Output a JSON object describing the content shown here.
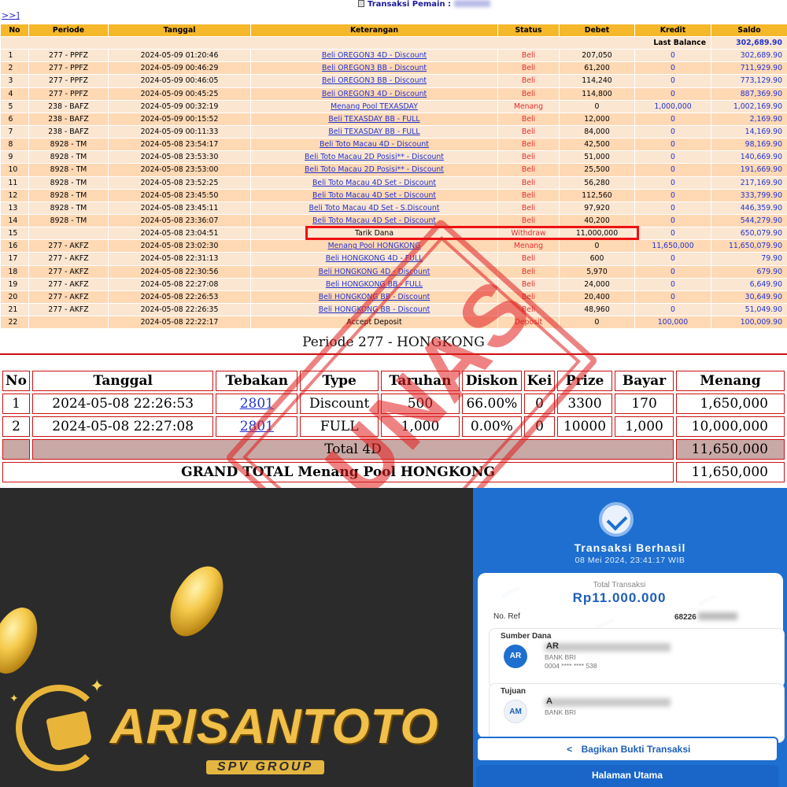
{
  "header": {
    "nav_label": ">>]",
    "title": "Transaksi   Pemain :",
    "player_icon": "document-icon"
  },
  "tx_table": {
    "columns": [
      "No",
      "Periode",
      "Tanggal",
      "Keterangan",
      "Status",
      "Debet",
      "Kredit",
      "Saldo"
    ],
    "last_balance_label": "Last Balance",
    "last_balance_value": "302,689.90",
    "rows": [
      {
        "no": "1",
        "periode": "277 - PPFZ",
        "tanggal": "2024-05-09 01:20:46",
        "ket": "Beli OREGON3 4D - Discount",
        "status": "Beli",
        "debet": "207,050",
        "kredit": "0",
        "saldo": "302,689.90",
        "link": true,
        "highlight": false
      },
      {
        "no": "2",
        "periode": "277 - PPFZ",
        "tanggal": "2024-05-09 00:46:29",
        "ket": "Beli OREGON3 BB - Discount",
        "status": "Beli",
        "debet": "61,200",
        "kredit": "0",
        "saldo": "711,929.90",
        "link": true,
        "highlight": false
      },
      {
        "no": "3",
        "periode": "277 - PPFZ",
        "tanggal": "2024-05-09 00:46:05",
        "ket": "Beli OREGON3 BB - Discount",
        "status": "Beli",
        "debet": "114,240",
        "kredit": "0",
        "saldo": "773,129.90",
        "link": true,
        "highlight": false
      },
      {
        "no": "4",
        "periode": "277 - PPFZ",
        "tanggal": "2024-05-09 00:45:25",
        "ket": "Beli OREGON3 4D - Discount",
        "status": "Beli",
        "debet": "114,800",
        "kredit": "0",
        "saldo": "887,369.90",
        "link": true,
        "highlight": false
      },
      {
        "no": "5",
        "periode": "238 - BAFZ",
        "tanggal": "2024-05-09 00:32:19",
        "ket": "Menang Pool TEXASDAY",
        "status": "Menang",
        "debet": "0",
        "kredit": "1,000,000",
        "saldo": "1,002,169.90",
        "link": true,
        "highlight": false
      },
      {
        "no": "6",
        "periode": "238 - BAFZ",
        "tanggal": "2024-05-09 00:15:52",
        "ket": "Beli TEXASDAY BB - FULL",
        "status": "Beli",
        "debet": "12,000",
        "kredit": "0",
        "saldo": "2,169.90",
        "link": true,
        "highlight": false
      },
      {
        "no": "7",
        "periode": "238 - BAFZ",
        "tanggal": "2024-05-09 00:11:33",
        "ket": "Beli TEXASDAY BB - FULL",
        "status": "Beli",
        "debet": "84,000",
        "kredit": "0",
        "saldo": "14,169.90",
        "link": true,
        "highlight": false
      },
      {
        "no": "8",
        "periode": "8928 - TM",
        "tanggal": "2024-05-08 23:54:17",
        "ket": "Beli Toto Macau 4D - Discount",
        "status": "Beli",
        "debet": "42,500",
        "kredit": "0",
        "saldo": "98,169.90",
        "link": true,
        "highlight": false
      },
      {
        "no": "9",
        "periode": "8928 - TM",
        "tanggal": "2024-05-08 23:53:30",
        "ket": "Beli Toto Macau 2D Posisi** - Discount",
        "status": "Beli",
        "debet": "51,000",
        "kredit": "0",
        "saldo": "140,669.90",
        "link": true,
        "highlight": false
      },
      {
        "no": "10",
        "periode": "8928 - TM",
        "tanggal": "2024-05-08 23:53:00",
        "ket": "Beli Toto Macau 2D Posisi** - Discount",
        "status": "Beli",
        "debet": "25,500",
        "kredit": "0",
        "saldo": "191,669.90",
        "link": true,
        "highlight": false
      },
      {
        "no": "11",
        "periode": "8928 - TM",
        "tanggal": "2024-05-08 23:52:25",
        "ket": "Beli Toto Macau 4D Set - Discount",
        "status": "Beli",
        "debet": "56,280",
        "kredit": "0",
        "saldo": "217,169.90",
        "link": true,
        "highlight": false
      },
      {
        "no": "12",
        "periode": "8928 - TM",
        "tanggal": "2024-05-08 23:45:50",
        "ket": "Beli Toto Macau 4D Set - Discount",
        "status": "Beli",
        "debet": "112,560",
        "kredit": "0",
        "saldo": "333,799.90",
        "link": true,
        "highlight": false
      },
      {
        "no": "13",
        "periode": "8928 - TM",
        "tanggal": "2024-05-08 23:45:11",
        "ket": "Beli Toto Macau 4D Set - S.Discount",
        "status": "Beli",
        "debet": "97,920",
        "kredit": "0",
        "saldo": "446,359.90",
        "link": true,
        "highlight": false
      },
      {
        "no": "14",
        "periode": "8928 - TM",
        "tanggal": "2024-05-08 23:36:07",
        "ket": "Beli Toto Macau 4D Set - Discount",
        "status": "Beli",
        "debet": "40,200",
        "kredit": "0",
        "saldo": "544,279.90",
        "link": true,
        "highlight": false
      },
      {
        "no": "15",
        "periode": "",
        "tanggal": "2024-05-08 23:04:51",
        "ket": "Tarik Dana",
        "status": "Withdraw",
        "debet": "11,000,000",
        "kredit": "0",
        "saldo": "650,079.90",
        "link": false,
        "highlight": true
      },
      {
        "no": "16",
        "periode": "277 - AKFZ",
        "tanggal": "2024-05-08 23:02:30",
        "ket": "Menang Pool HONGKONG",
        "status": "Menang",
        "debet": "0",
        "kredit": "11,650,000",
        "saldo": "11,650,079.90",
        "link": true,
        "highlight": false
      },
      {
        "no": "17",
        "periode": "277 - AKFZ",
        "tanggal": "2024-05-08 22:31:13",
        "ket": "Beli HONGKONG 4D - FULL",
        "status": "Beli",
        "debet": "600",
        "kredit": "0",
        "saldo": "79.90",
        "link": true,
        "highlight": false
      },
      {
        "no": "18",
        "periode": "277 - AKFZ",
        "tanggal": "2024-05-08 22:30:56",
        "ket": "Beli HONGKONG 4D - Discount",
        "status": "Beli",
        "debet": "5,970",
        "kredit": "0",
        "saldo": "679.90",
        "link": true,
        "highlight": false
      },
      {
        "no": "19",
        "periode": "277 - AKFZ",
        "tanggal": "2024-05-08 22:27:08",
        "ket": "Beli HONGKONG BB - FULL",
        "status": "Beli",
        "debet": "24,000",
        "kredit": "0",
        "saldo": "6,649.90",
        "link": true,
        "highlight": false
      },
      {
        "no": "20",
        "periode": "277 - AKFZ",
        "tanggal": "2024-05-08 22:26:53",
        "ket": "Beli HONGKONG BB - Discount",
        "status": "Beli",
        "debet": "20,400",
        "kredit": "0",
        "saldo": "30,649.90",
        "link": true,
        "highlight": false
      },
      {
        "no": "21",
        "periode": "277 - AKFZ",
        "tanggal": "2024-05-08 22:26:35",
        "ket": "Beli HONGKONG BB - Discount",
        "status": "Beli",
        "debet": "48,960",
        "kredit": "0",
        "saldo": "51,049.90",
        "link": true,
        "highlight": false
      },
      {
        "no": "22",
        "periode": "",
        "tanggal": "2024-05-08 22:22:17",
        "ket": "Accept Deposit",
        "status": "Deposit",
        "debet": "0",
        "kredit": "100,000",
        "saldo": "100,009.90",
        "link": false,
        "highlight": false
      }
    ]
  },
  "periode": {
    "title": "Periode 277 - HONGKONG",
    "columns": [
      "No",
      "Tanggal",
      "Tebakan",
      "Type",
      "Taruhan",
      "Diskon",
      "Kei",
      "Prize",
      "Bayar",
      "Menang"
    ],
    "rows": [
      {
        "no": "1",
        "tanggal": "2024-05-08 22:26:53",
        "tebakan": "2801",
        "type": "Discount",
        "taruhan": "500",
        "diskon": "66.00%",
        "kei": "0",
        "prize": "3300",
        "bayar": "170",
        "menang": "1,650,000"
      },
      {
        "no": "2",
        "tanggal": "2024-05-08 22:27:08",
        "tebakan": "2801",
        "type": "FULL",
        "taruhan": "1,000",
        "diskon": "0.00%",
        "kei": "0",
        "prize": "10000",
        "bayar": "1,000",
        "menang": "10,000,000"
      }
    ],
    "total_label": "Total 4D",
    "total_value": "11,650,000",
    "grand_total_label": "GRAND TOTAL  Menang Pool HONGKONG",
    "grand_total_value": "11,650,000"
  },
  "stamp": {
    "text": "LUNAS",
    "color": "#e02020"
  },
  "promo": {
    "brand": "ARISANTOTO",
    "sub": "SPV GROUP",
    "accent": "#f1c04a"
  },
  "receipt": {
    "title": "Transaksi Berhasil",
    "date": "08 Mei 2024, 23:41:17 WIB",
    "total_label": "Total Transaksi",
    "amount": "Rp11.000.000",
    "ref_label": "No. Ref",
    "ref_value": "68226",
    "sender_title": "Sumber Dana",
    "sender_initials": "AR",
    "sender_name": "AR",
    "sender_bank": "BANK BRI",
    "sender_account": "0004 **** **** 538",
    "recipient_title": "Tujuan",
    "recipient_initials": "AM",
    "recipient_name": "A",
    "recipient_bank": "BANK BRI",
    "recipient_account": "",
    "share_label": "Bagikan Bukti Transaksi",
    "home_label": "Halaman Utama",
    "watermark": "BRImo",
    "accent": "#1e6fd0"
  }
}
